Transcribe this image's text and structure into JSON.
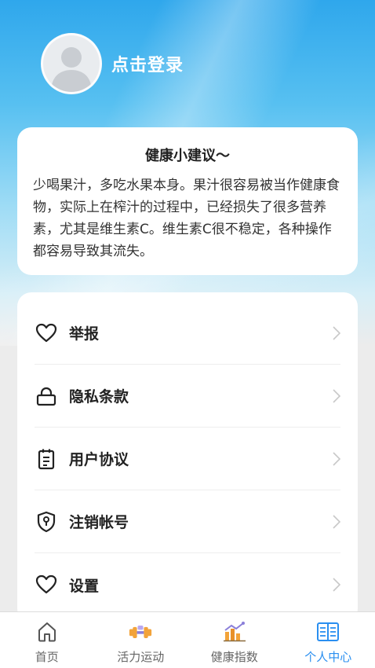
{
  "profile": {
    "login_label": "点击登录",
    "avatar_icon": "user-placeholder-icon"
  },
  "tip": {
    "title": "健康小建议～",
    "body": "少喝果汁，多吃水果本身。果汁很容易被当作健康食物，实际上在榨汁的过程中，已经损失了很多营养素，尤其是维生素C。维生素C很不稳定，各种操作都容易导致其流失。"
  },
  "menu": {
    "items": [
      {
        "label": "举报",
        "icon": "heart-icon"
      },
      {
        "label": "隐私条款",
        "icon": "lock-icon"
      },
      {
        "label": "用户协议",
        "icon": "document-icon"
      },
      {
        "label": "注销帐号",
        "icon": "shield-key-icon"
      },
      {
        "label": "设置",
        "icon": "heart-icon"
      }
    ]
  },
  "tabbar": {
    "tabs": [
      {
        "label": "首页",
        "icon": "home-icon",
        "active": false
      },
      {
        "label": "活力运动",
        "icon": "dumbbell-icon",
        "active": false
      },
      {
        "label": "健康指数",
        "icon": "chart-icon",
        "active": false
      },
      {
        "label": "个人中心",
        "icon": "book-icon",
        "active": true
      }
    ]
  },
  "colors": {
    "accent": "#2a8ff0",
    "hero_top": "#2fa7ec",
    "background": "#ececec"
  }
}
